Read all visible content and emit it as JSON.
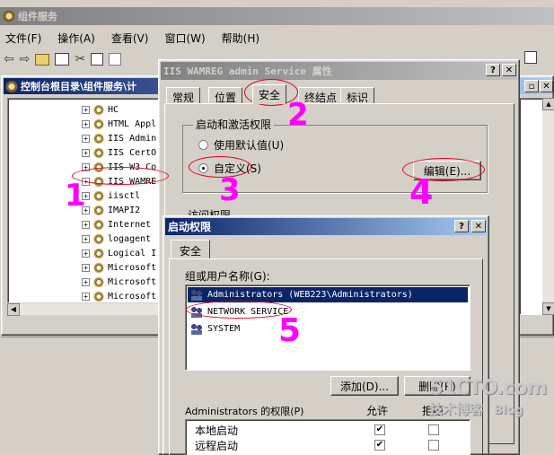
{
  "mmc": {
    "title": "组件服务",
    "menu": [
      "文件(F)",
      "操作(A)",
      "查看(V)",
      "窗口(W)",
      "帮助(H)"
    ],
    "child_title": "控制台根目录\\组件服务\\计",
    "tree_items": [
      "HC",
      "HTML Appl",
      "IIS Admin",
      "IIS CertO",
      "IIS W3 Co",
      "IIS WAMRE",
      "iisctl",
      "IMAPI2",
      "Internet",
      "logagent",
      "Logical I",
      "Microsoft",
      "Microsoft",
      "Microsoft"
    ]
  },
  "props": {
    "title": "IIS WAMREG admin Service 属性",
    "tabs": [
      "常规",
      "位置",
      "安全",
      "终结点",
      "标识"
    ],
    "launch_group": "启动和激活权限",
    "default_radio": "使用默认值(U)",
    "custom_radio": "自定义(S)",
    "edit_button": "编辑(E)...",
    "access_group": "访问权限"
  },
  "launch": {
    "title": "启动权限",
    "tab": "安全",
    "group_label": "组或用户名称(G):",
    "users": [
      "Administrators (WEB223\\Administrators)",
      "NETWORK SERVICE",
      "SYSTEM"
    ],
    "add_button": "添加(D)...",
    "remove_button": "删除(R)",
    "perm_label": "Administrators 的权限(P)",
    "allow_header": "允许",
    "deny_header": "拒绝",
    "perms": [
      {
        "name": "本地启动",
        "allow": true,
        "deny": false
      },
      {
        "name": "远程启动",
        "allow": true,
        "deny": false
      }
    ]
  },
  "annotations": [
    "1",
    "2",
    "3",
    "4",
    "5"
  ],
  "watermark": {
    "line1": "51CTO.com",
    "line2": "技术博客",
    "line3": "Blog"
  },
  "colors": {
    "annotation": "#ff00ff",
    "ring": "#e00020",
    "titlebar": "#0a246a"
  }
}
